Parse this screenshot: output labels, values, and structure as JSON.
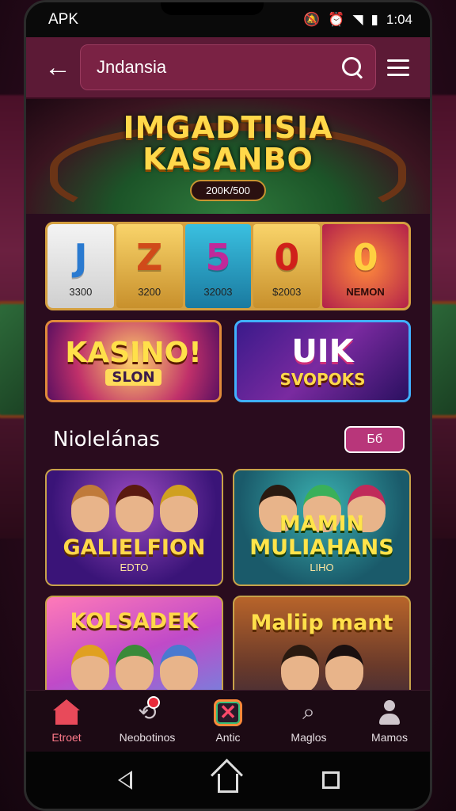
{
  "status_bar": {
    "carrier": "APK",
    "time": "1:04",
    "icons": [
      "mute-icon",
      "alarm-icon",
      "wifi-icon",
      "signal-icon",
      "battery-icon"
    ]
  },
  "header": {
    "back_icon": "arrow-left-icon",
    "search_value": "Jndansia",
    "search_icon": "search-icon",
    "menu_icon": "hamburger-menu-icon"
  },
  "hero": {
    "title_line1": "IMGADTISIA",
    "title_line2": "KASANBO",
    "badge": "200K/500"
  },
  "slot_strip": {
    "reels": [
      {
        "symbol": "J",
        "amount": "3300",
        "color": "#2a7ad0"
      },
      {
        "symbol": "Z",
        "amount": "3200",
        "color": "#d04a1a"
      },
      {
        "symbol": "5",
        "amount": "32003",
        "color": "#c02a9a"
      },
      {
        "symbol": "0",
        "amount": "$2003",
        "color": "#d0201a"
      },
      {
        "symbol": "0",
        "amount": "NEMON",
        "color": "#ffd040"
      }
    ]
  },
  "promos": [
    {
      "title": "KASINO!",
      "subtitle": "SLON"
    },
    {
      "title": "UIK",
      "subtitle": "SVOPOKS"
    }
  ],
  "section": {
    "title": "Niolelánas",
    "button": "Бб"
  },
  "games": [
    {
      "title": "GALIELFION",
      "subtitle": "EDTO"
    },
    {
      "title": "MAMIN MULIAHANS",
      "subtitle": "LIHO"
    },
    {
      "title": "KOLSADEK",
      "subtitle": ""
    },
    {
      "title": "Maliip mant",
      "subtitle": ""
    }
  ],
  "bottom_nav": [
    {
      "label": "Etroet",
      "icon": "home-icon",
      "active": true
    },
    {
      "label": "Neobotinos",
      "icon": "gift-icon",
      "active": false
    },
    {
      "label": "Antic",
      "icon": "games-x-icon",
      "active": false
    },
    {
      "label": "Maglos",
      "icon": "search-magnifier-icon",
      "active": false
    },
    {
      "label": "Mamos",
      "icon": "user-icon",
      "active": false
    }
  ],
  "colors": {
    "header_bg": "#5c1a36",
    "accent": "#b8367a",
    "gold": "#d4a040",
    "active_nav": "#e84a5a"
  }
}
